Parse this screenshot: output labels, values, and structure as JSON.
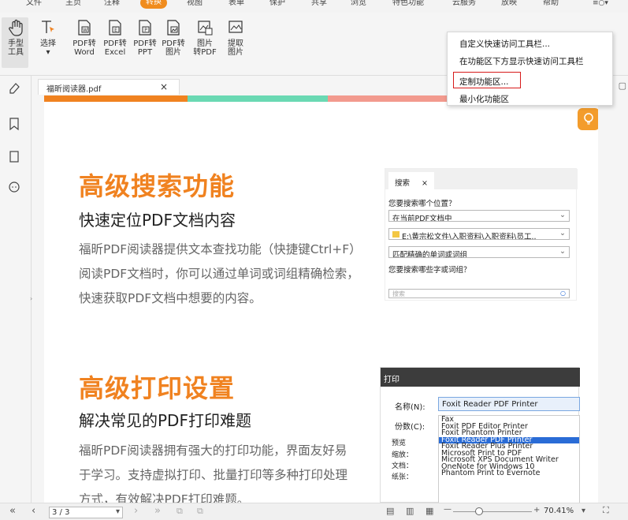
{
  "menu": {
    "items": [
      "文件",
      "主页",
      "注释",
      "转换",
      "视图",
      "表单",
      "保护",
      "共享",
      "浏览",
      "特色功能",
      "云服务",
      "放映",
      "帮助"
    ],
    "active": "转换",
    "search_icon": "search-icon"
  },
  "ribbon": {
    "hand": "手型\n工具",
    "hand_l1": "手型",
    "hand_l2": "工具",
    "select": "选择",
    "pdf_word_l1": "PDF转",
    "pdf_word_l2": "Word",
    "pdf_excel_l1": "PDF转",
    "pdf_excel_l2": "Excel",
    "pdf_ppt_l1": "PDF转",
    "pdf_ppt_l2": "PPT",
    "pdf_img_l1": "PDF转",
    "pdf_img_l2": "图片",
    "img_pdf_l1": "图片",
    "img_pdf_l2": "转PDF",
    "extract_l1": "提取",
    "extract_l2": "图片"
  },
  "context_menu": {
    "item1": "自定义快速访问工具栏...",
    "item2": "在功能区下方显示快速访问工具栏",
    "item3": "定制功能区...",
    "item4": "最小化功能区",
    "highlight_color": "#d71a1a"
  },
  "tab": {
    "filename": "福昕阅读器.pdf",
    "close": "×"
  },
  "progress_colors": [
    "#f08220",
    "#6ad9b3",
    "#f29a8e"
  ],
  "doc": {
    "section1": {
      "title": "高级搜索功能",
      "subtitle": "快速定位PDF文档内容",
      "line1": "福昕PDF阅读器提供文本查找功能（快捷键Ctrl+F）",
      "line2": "阅读PDF文档时，你可以通过单词或词组精确检索，",
      "line3": "快速获取PDF文档中想要的内容。"
    },
    "section2": {
      "title": "高级打印设置",
      "subtitle": "解决常见的PDF打印难题",
      "line1": "福昕PDF阅读器拥有强大的打印功能，界面友好易",
      "line2": "于学习。支持虚拟打印、批量打印等多种打印处理",
      "line3": "方式，有效解决PDF打印难题。"
    },
    "search_panel": {
      "tab": "搜索",
      "close": "×",
      "q1": "您要搜索哪个位置？",
      "opt1": "在当前PDF文档中",
      "path": "E:\\黄宗松文件\\入职资料\\入职资料\\员工..",
      "opt2": "匹配精确的单词或词组",
      "q2": "您要搜索哪些字或词组？",
      "search_placeholder": "搜索"
    },
    "print_dialog": {
      "title": "打印",
      "name_label": "名称(N):",
      "name_value": "Foxit Reader PDF Printer",
      "copies_label": "份数(C):",
      "preview_label": "预览",
      "zoom_label": "缩放：",
      "doc_label": "文档：",
      "paper_label": "纸张：",
      "printers": [
        "Fax",
        "Foxit PDF Editor Printer",
        "Foxit Phantom Printer",
        "Foxit Reader PDF Printer",
        "Foxit Reader Plus Printer",
        "Microsoft Print to PDF",
        "Microsoft XPS Document Writer",
        "OneNote for Windows 10",
        "Phantom Print to Evernote"
      ],
      "selected_index": 3
    }
  },
  "status": {
    "page": "3 / 3",
    "zoom": "70.41%",
    "plus": "+",
    "minus": "—"
  }
}
